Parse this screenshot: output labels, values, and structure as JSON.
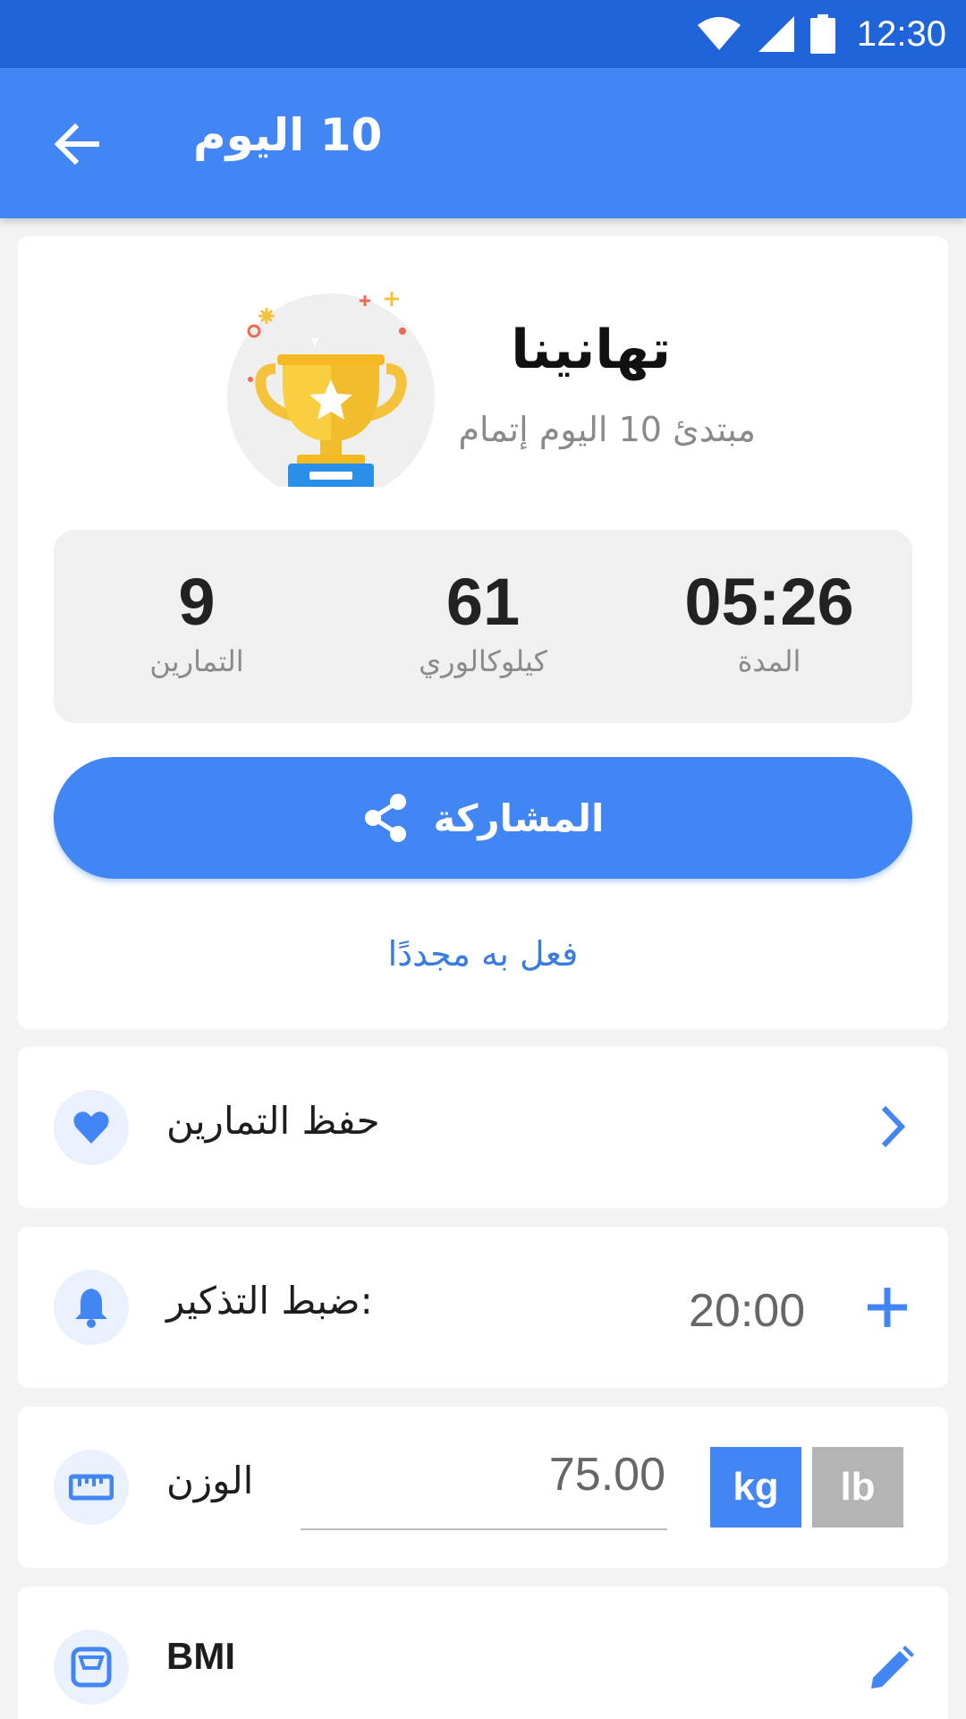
{
  "status_bar": {
    "time": "12:30",
    "icons": [
      "wifi-icon",
      "signal-icon",
      "battery-icon"
    ]
  },
  "app_bar": {
    "title": "10 اليوم",
    "back_icon": "arrow-back-icon"
  },
  "result": {
    "congrats": "تهانينا",
    "subtitle": "مبتدئ 10 اليوم إتمام",
    "stats": [
      {
        "value": "9",
        "label": "التمارين"
      },
      {
        "value": "61",
        "label": "كيلوكالوري"
      },
      {
        "value": "05:26",
        "label": "المدة"
      }
    ],
    "share_label": "المشاركة",
    "redo_label": "فعل به مجددًا"
  },
  "save_workout": {
    "label": "حفظ التمارين",
    "icon": "heart-icon"
  },
  "reminder": {
    "label": "ضبط التذكير:",
    "time": "20:00",
    "icon": "bell-icon"
  },
  "weight": {
    "label": "الوزن",
    "value": "75.00",
    "unit_kg": "kg",
    "unit_lb": "lb",
    "selected_unit": "kg",
    "icon": "ruler-icon"
  },
  "bmi": {
    "label": "BMI",
    "icon": "scale-icon"
  },
  "colors": {
    "primary": "#4285f4",
    "status_bar": "#1f65d9",
    "accent_text": "#3a7be0",
    "background": "#f3f3f3"
  }
}
